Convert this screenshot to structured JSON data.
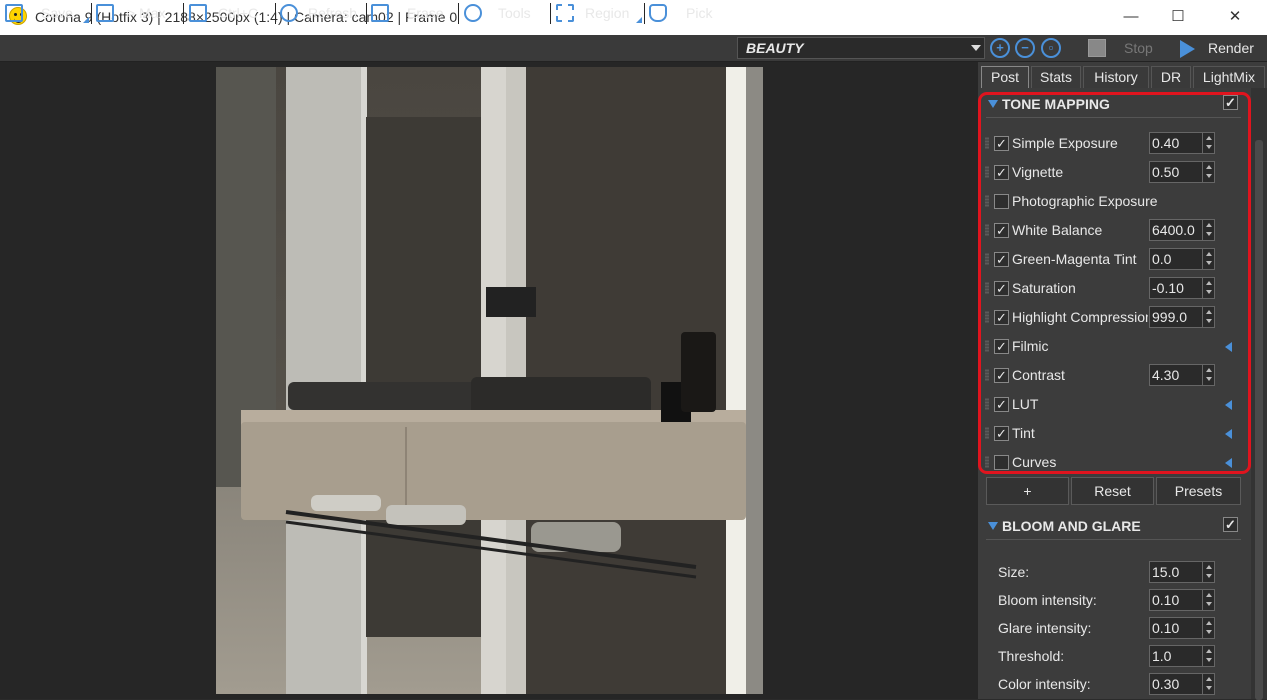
{
  "window": {
    "title": "Corona 9 (Hotfix 3) | 2188×2500px (1:4) | Camera: cam02 | Frame 0",
    "minimize": "—",
    "maximize": "☐",
    "close": "✕"
  },
  "toolbar": {
    "save": "Save",
    "max": "> Max",
    "copy": "Ctrl+C",
    "refresh": "Refresh",
    "erase": "Erase",
    "tools": "Tools",
    "region": "Region",
    "pick": "Pick",
    "channel": "BEAUTY",
    "stop": "Stop",
    "render": "Render",
    "accent_color": "#4a90d9"
  },
  "tabs": [
    "Post",
    "Stats",
    "History",
    "DR",
    "LightMix"
  ],
  "tone_mapping": {
    "title": "TONE MAPPING",
    "enabled": "✓",
    "rows": [
      {
        "label": "Simple Exposure",
        "check": "✓",
        "value": "0.40"
      },
      {
        "label": "Vignette",
        "check": "✓",
        "value": "0.50"
      },
      {
        "label": "Photographic Exposure",
        "check": ""
      },
      {
        "label": "White Balance",
        "check": "✓",
        "value": "6400.0"
      },
      {
        "label": "Green-Magenta Tint",
        "check": "✓",
        "value": "0.0"
      },
      {
        "label": "Saturation",
        "check": "✓",
        "value": "-0.10"
      },
      {
        "label": "Highlight Compression",
        "check": "✓",
        "value": "999.0"
      },
      {
        "label": "Filmic",
        "check": "✓"
      },
      {
        "label": "Contrast",
        "check": "✓",
        "value": "4.30"
      },
      {
        "label": "LUT",
        "check": "✓"
      },
      {
        "label": "Tint",
        "check": "✓"
      },
      {
        "label": "Curves",
        "check": ""
      }
    ],
    "highlight_color": "#e0141e"
  },
  "buttons": {
    "add": "+",
    "reset": "Reset",
    "presets": "Presets"
  },
  "bloom": {
    "title": "BLOOM AND GLARE",
    "enabled": "✓",
    "rows": [
      {
        "label": "Size:",
        "value": "15.0"
      },
      {
        "label": "Bloom intensity:",
        "value": "0.10"
      },
      {
        "label": "Glare intensity:",
        "value": "0.10"
      },
      {
        "label": "Threshold:",
        "value": "1.0"
      },
      {
        "label": "Color intensity:",
        "value": "0.30"
      }
    ]
  }
}
